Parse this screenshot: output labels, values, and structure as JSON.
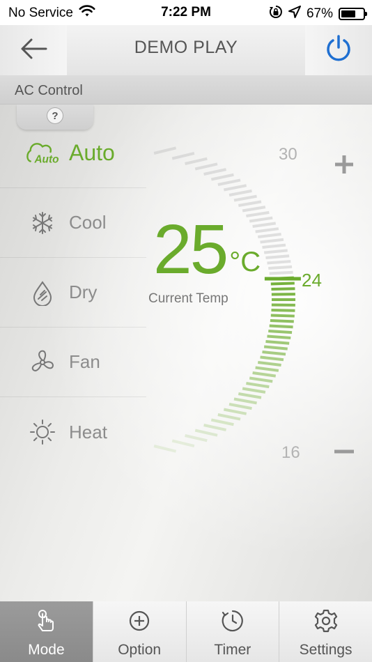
{
  "status_bar": {
    "carrier": "No Service",
    "time": "7:22 PM",
    "battery_text": "67%",
    "battery_level": 0.67
  },
  "header": {
    "title": "DEMO PLAY"
  },
  "section": {
    "label": "AC Control",
    "help_symbol": "?"
  },
  "modes": [
    {
      "label": "Auto",
      "icon": "auto-mode-icon",
      "active": true
    },
    {
      "label": "Cool",
      "icon": "snowflake-icon",
      "active": false
    },
    {
      "label": "Dry",
      "icon": "droplet-icon",
      "active": false
    },
    {
      "label": "Fan",
      "icon": "fan-icon",
      "active": false
    },
    {
      "label": "Heat",
      "icon": "sun-icon",
      "active": false
    }
  ],
  "temperature": {
    "current": "25",
    "unit": "°C",
    "caption": "Current Temp",
    "set_point": "24",
    "scale_max": "30",
    "scale_min": "16"
  },
  "tabs": [
    {
      "label": "Mode",
      "icon": "hand-tap-icon",
      "active": true
    },
    {
      "label": "Option",
      "icon": "plus-circle-icon",
      "active": false
    },
    {
      "label": "Timer",
      "icon": "clock-icon",
      "active": false
    },
    {
      "label": "Settings",
      "icon": "gear-icon",
      "active": false
    }
  ],
  "colors": {
    "accent": "#6aab2c",
    "power_blue": "#1f6fd1",
    "inactive_text": "#8c8c8c"
  }
}
